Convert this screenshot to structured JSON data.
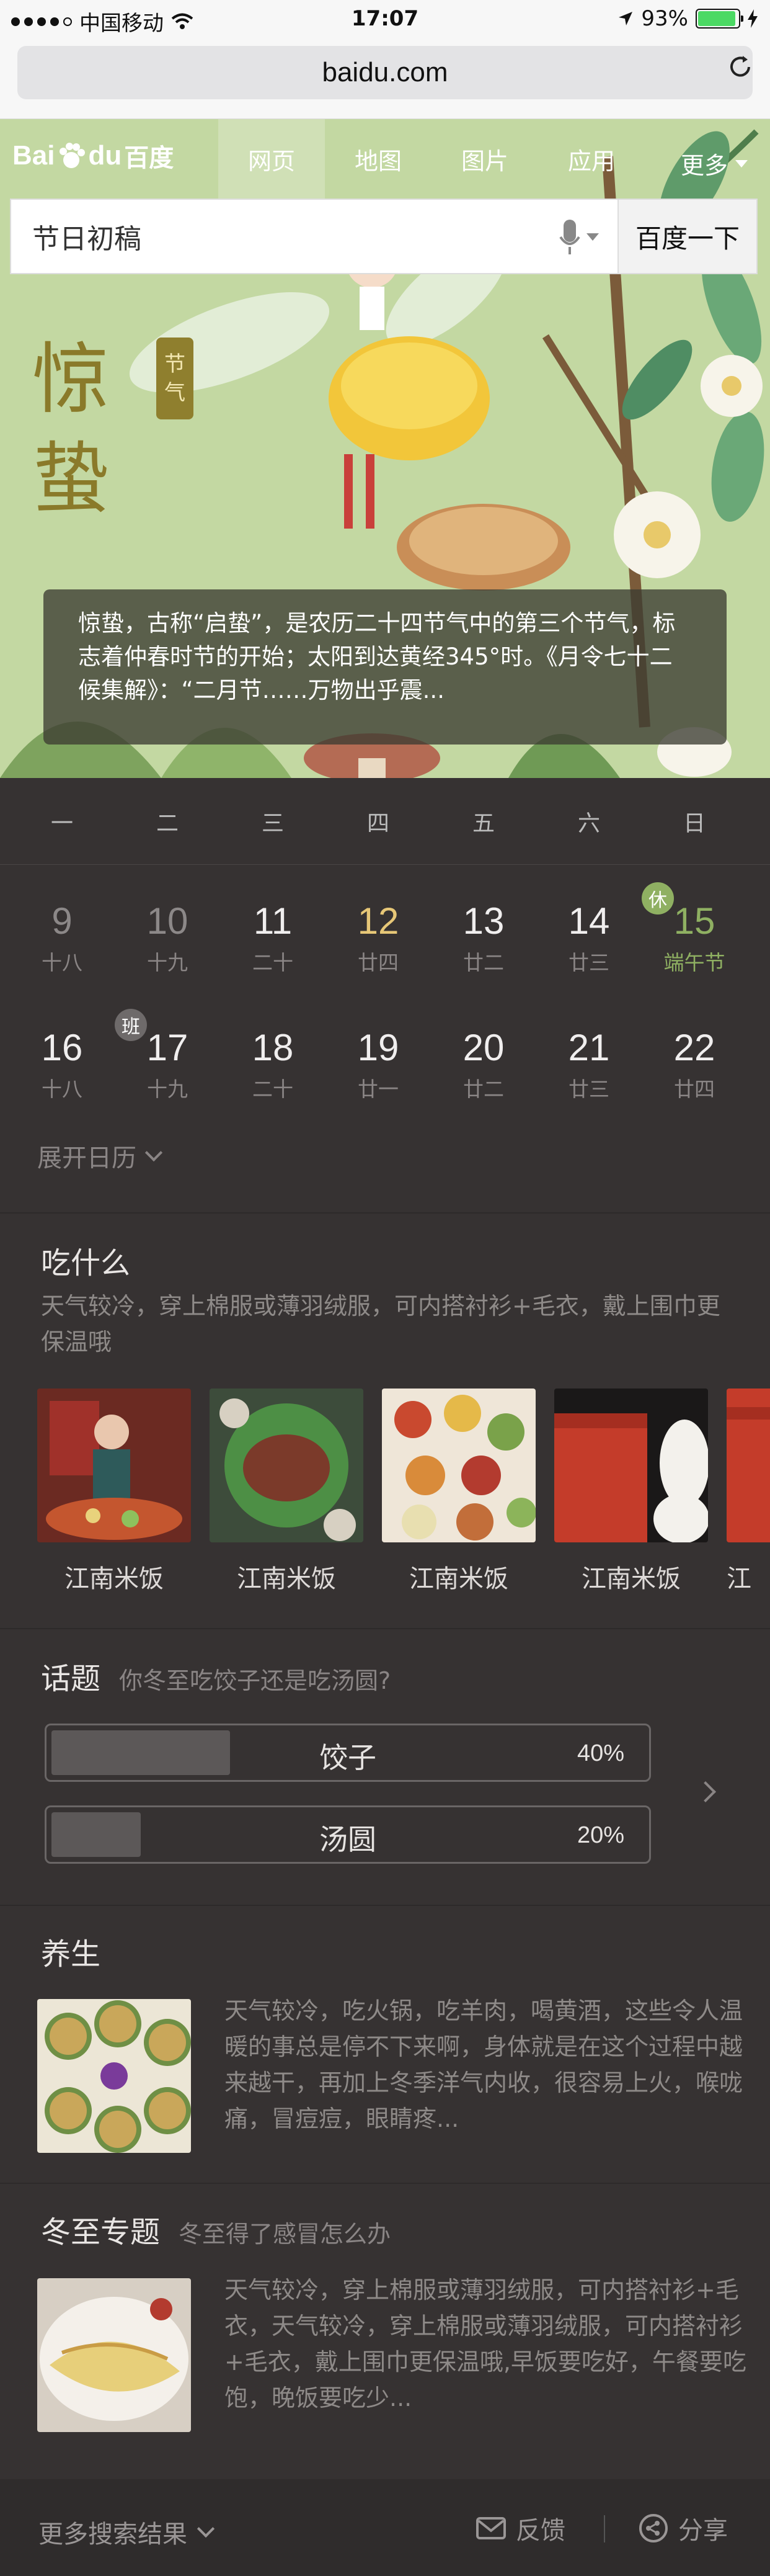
{
  "status_bar": {
    "carrier": "中国移动",
    "time": "17:07",
    "battery": "93%",
    "battery_level": 0.93
  },
  "browser": {
    "url": "baidu.com"
  },
  "nav": {
    "logo_text": "Bai",
    "logo_text2": "du",
    "logo_cn": "百度",
    "tabs": [
      {
        "label": "网页",
        "active": true
      },
      {
        "label": "地图"
      },
      {
        "label": "图片"
      },
      {
        "label": "应用"
      }
    ],
    "more": "更多"
  },
  "search": {
    "query": "节日初稿",
    "button": "百度一下"
  },
  "hero": {
    "title": "惊蛰",
    "seal": [
      "节",
      "气"
    ],
    "description": "惊蛰，古称“启蛰”，是农历二十四节气中的第三个节气，标志着仲春时节的开始；太阳到达黄经345°时。《月令七十二候集解》：“二月节……万物出乎震..."
  },
  "calendar": {
    "weekdays": [
      "一",
      "二",
      "三",
      "四",
      "五",
      "六",
      "日"
    ],
    "rows": [
      [
        {
          "day": "9",
          "lunar": "十八",
          "style": "dim"
        },
        {
          "day": "10",
          "lunar": "十九",
          "style": "dim"
        },
        {
          "day": "11",
          "lunar": "二十",
          "style": "normal"
        },
        {
          "day": "12",
          "lunar": "廿四",
          "style": "gold"
        },
        {
          "day": "13",
          "lunar": "廿二",
          "style": "normal"
        },
        {
          "day": "14",
          "lunar": "廿三",
          "style": "normal"
        },
        {
          "day": "15",
          "lunar": "端午节",
          "style": "green",
          "badge": "休"
        }
      ],
      [
        {
          "day": "16",
          "lunar": "十八",
          "style": "normal"
        },
        {
          "day": "17",
          "lunar": "十九",
          "style": "normal",
          "badge": "班"
        },
        {
          "day": "18",
          "lunar": "二十",
          "style": "normal"
        },
        {
          "day": "19",
          "lunar": "廿一",
          "style": "normal"
        },
        {
          "day": "20",
          "lunar": "廿二",
          "style": "normal"
        },
        {
          "day": "21",
          "lunar": "廿三",
          "style": "normal"
        },
        {
          "day": "22",
          "lunar": "廿四",
          "style": "normal"
        }
      ]
    ],
    "expand_label": "展开日历"
  },
  "eat": {
    "title": "吃什么",
    "text": "天气较冷，穿上棉服或薄羽绒服，可内搭衬衫+毛衣，戴上围巾更保温哦",
    "items": [
      "江南米饭",
      "江南米饭",
      "江南米饭",
      "江南米饭",
      "江"
    ]
  },
  "topic": {
    "title": "话题",
    "question": "你冬至吃饺子还是吃汤圆?",
    "options": [
      {
        "label": "饺子",
        "percent": "40%",
        "value": 0.4
      },
      {
        "label": "汤圆",
        "percent": "20%",
        "value": 0.2
      }
    ]
  },
  "health": {
    "title": "养生",
    "text": "天气较冷，吃火锅，吃羊肉，喝黄酒，这些令人温暖的事总是停不下来啊，身体就是在这个过程中越来越干，再加上冬季洋气内收，很容易上火，喉咙痛，冒痘痘，眼睛疼..."
  },
  "special": {
    "title": "冬至专题",
    "subtitle": "冬至得了感冒怎么办",
    "text": "天气较冷，穿上棉服或薄羽绒服，可内搭衬衫+毛衣，天气较冷，穿上棉服或薄羽绒服，可内搭衬衫+毛衣，戴上围巾更保温哦,早饭要吃好，午餐要吃饱，晚饭要吃少..."
  },
  "footer": {
    "more": "更多搜索结果",
    "feedback": "反馈",
    "share": "分享"
  }
}
